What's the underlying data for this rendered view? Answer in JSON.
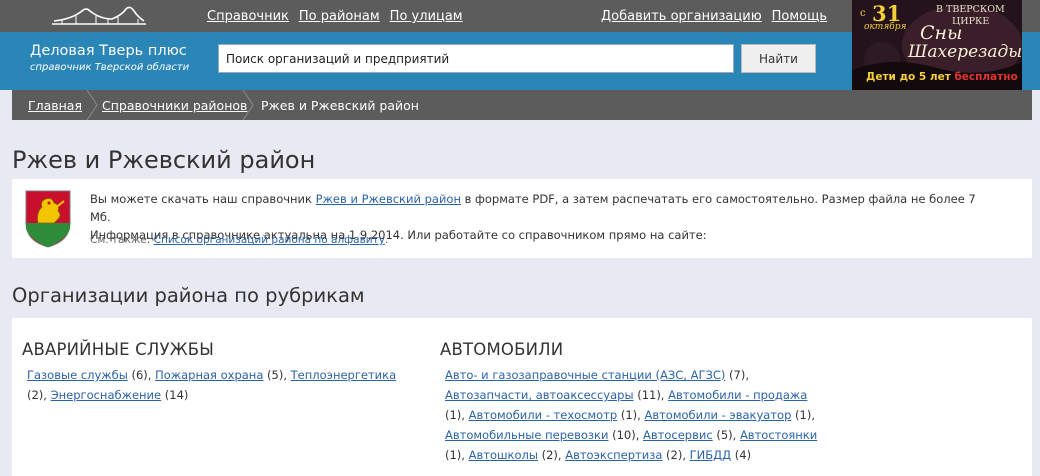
{
  "topnav": {
    "items": [
      {
        "label": "Справочник"
      },
      {
        "label": "По районам"
      },
      {
        "label": "По улицам"
      }
    ],
    "add_org": "Добавить организацию",
    "help": "Помощь"
  },
  "brand": {
    "title": "Деловая Тверь плюс",
    "subtitle": "справочник Тверской области"
  },
  "search": {
    "value": "Поиск организаций и предприятий",
    "button": "Найти"
  },
  "ad": {
    "venue": "В ТВЕРСКОМ",
    "venue2": "ЦИРКЕ",
    "prefix": "с",
    "day": "31",
    "month": "октября",
    "show_line1": "Сны",
    "show_line2": "Шахерезады",
    "bottom_main": "Дети до 5 лет ",
    "bottom_accent": "бесплатно"
  },
  "breadcrumb": {
    "home": "Главная",
    "districts": "Справочники районов",
    "current": "Ржев и Ржевский район"
  },
  "page": {
    "title": "Ржев и Ржевский район"
  },
  "info": {
    "text_before": "Вы можете скачать наш справочник ",
    "link": "Ржев и Ржевский район",
    "text_after": " в формате PDF, а затем распечатать его самостоятельно. Размер файла не более 7 Мб.",
    "line2": "Информация в справочнике актуальна на 1.9.2014. Или работайте со справочником прямо на сайте:",
    "see_also_label": "См. также: ",
    "see_also_link": "Список организаций района по алфавиту",
    "see_also_end": "."
  },
  "section": {
    "title": "Организации района по рубрикам"
  },
  "categories": [
    {
      "title": "АВАРИЙНЫЕ СЛУЖБЫ",
      "links": [
        {
          "label": "Газовые службы",
          "count": " (6), "
        },
        {
          "label": "Пожарная охрана",
          "count": " (5), "
        },
        {
          "label": "Теплоэнергетика",
          "count": " (2), "
        },
        {
          "label": "Энергоснабжение",
          "count": " (14)"
        }
      ]
    },
    {
      "title": "АВТОМОБИЛИ",
      "links": [
        {
          "label": "Авто- и газозаправочные станции (АЗС, АГЗС)",
          "count": " (7), "
        },
        {
          "label": "Автозапчасти, автоаксессуары",
          "count": " (11), "
        },
        {
          "label": "Автомобили - продажа",
          "count": " (1), "
        },
        {
          "label": "Автомобили - техосмотр",
          "count": " (1), "
        },
        {
          "label": "Автомобили - эвакуатор",
          "count": " (1), "
        },
        {
          "label": "Автомобильные перевозки",
          "count": " (10), "
        },
        {
          "label": "Автосервис",
          "count": " (5), "
        },
        {
          "label": "Автостоянки",
          "count": " (1), "
        },
        {
          "label": "Автошколы",
          "count": " (2), "
        },
        {
          "label": "Автоэкспертиза",
          "count": " (2), "
        },
        {
          "label": "ГИБДД",
          "count": " (4)"
        }
      ]
    }
  ]
}
